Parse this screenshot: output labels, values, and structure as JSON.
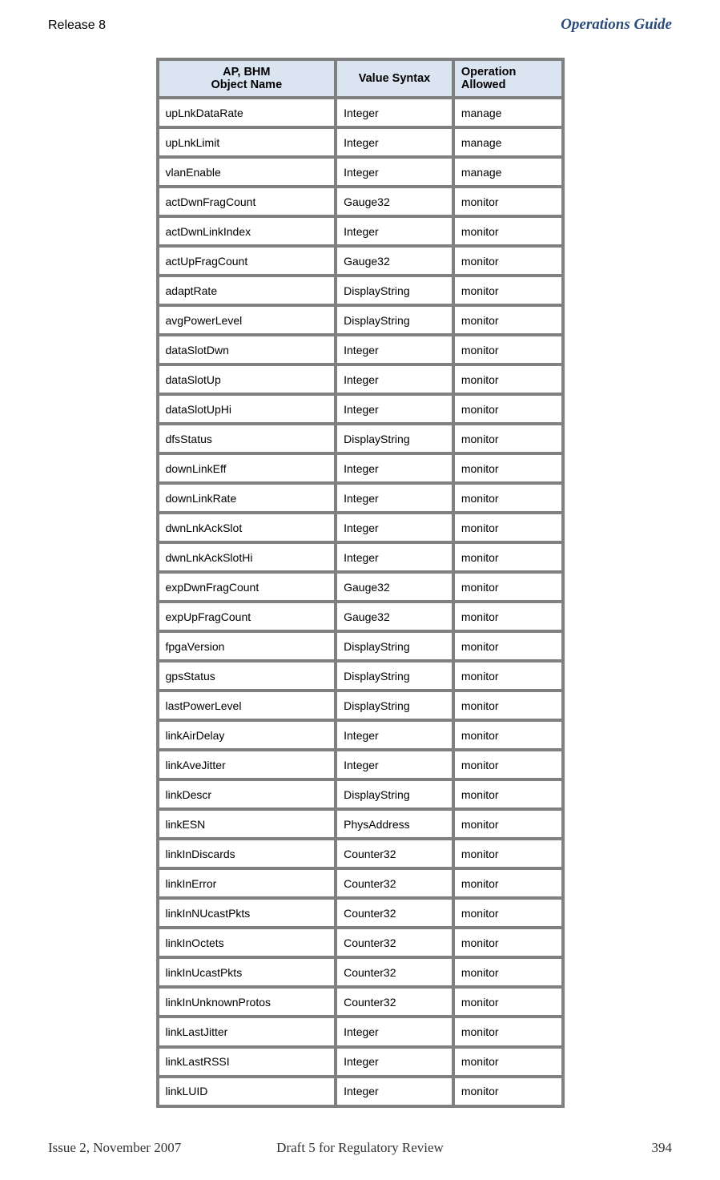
{
  "header": {
    "left": "Release 8",
    "right": "Operations Guide"
  },
  "footer": {
    "left": "Issue 2, November 2007",
    "center": "Draft 5 for Regulatory Review",
    "right": "394"
  },
  "table": {
    "headers": {
      "object_name_line1": "AP, BHM",
      "object_name_line2": "Object Name",
      "value_syntax": "Value Syntax",
      "operation_allowed_line1": "Operation",
      "operation_allowed_line2": "Allowed"
    },
    "rows": [
      {
        "name": "upLnkDataRate",
        "syntax": "Integer",
        "op": "manage"
      },
      {
        "name": "upLnkLimit",
        "syntax": "Integer",
        "op": "manage"
      },
      {
        "name": "vlanEnable",
        "syntax": "Integer",
        "op": "manage"
      },
      {
        "name": "actDwnFragCount",
        "syntax": "Gauge32",
        "op": "monitor"
      },
      {
        "name": "actDwnLinkIndex",
        "syntax": "Integer",
        "op": "monitor"
      },
      {
        "name": "actUpFragCount",
        "syntax": "Gauge32",
        "op": "monitor"
      },
      {
        "name": "adaptRate",
        "syntax": "DisplayString",
        "op": "monitor"
      },
      {
        "name": "avgPowerLevel",
        "syntax": "DisplayString",
        "op": "monitor"
      },
      {
        "name": "dataSlotDwn",
        "syntax": "Integer",
        "op": "monitor"
      },
      {
        "name": "dataSlotUp",
        "syntax": "Integer",
        "op": "monitor"
      },
      {
        "name": "dataSlotUpHi",
        "syntax": "Integer",
        "op": "monitor"
      },
      {
        "name": "dfsStatus",
        "syntax": "DisplayString",
        "op": "monitor"
      },
      {
        "name": "downLinkEff",
        "syntax": "Integer",
        "op": "monitor"
      },
      {
        "name": "downLinkRate",
        "syntax": "Integer",
        "op": "monitor"
      },
      {
        "name": "dwnLnkAckSlot",
        "syntax": "Integer",
        "op": "monitor"
      },
      {
        "name": "dwnLnkAckSlotHi",
        "syntax": "Integer",
        "op": "monitor"
      },
      {
        "name": "expDwnFragCount",
        "syntax": "Gauge32",
        "op": "monitor"
      },
      {
        "name": "expUpFragCount",
        "syntax": "Gauge32",
        "op": "monitor"
      },
      {
        "name": "fpgaVersion",
        "syntax": "DisplayString",
        "op": "monitor"
      },
      {
        "name": "gpsStatus",
        "syntax": "DisplayString",
        "op": "monitor"
      },
      {
        "name": "lastPowerLevel",
        "syntax": "DisplayString",
        "op": "monitor"
      },
      {
        "name": "linkAirDelay",
        "syntax": "Integer",
        "op": "monitor"
      },
      {
        "name": "linkAveJitter",
        "syntax": "Integer",
        "op": "monitor"
      },
      {
        "name": "linkDescr",
        "syntax": "DisplayString",
        "op": "monitor"
      },
      {
        "name": "linkESN",
        "syntax": "PhysAddress",
        "op": "monitor"
      },
      {
        "name": "linkInDiscards",
        "syntax": "Counter32",
        "op": "monitor"
      },
      {
        "name": "linkInError",
        "syntax": "Counter32",
        "op": "monitor"
      },
      {
        "name": "linkInNUcastPkts",
        "syntax": "Counter32",
        "op": "monitor"
      },
      {
        "name": "linkInOctets",
        "syntax": "Counter32",
        "op": "monitor"
      },
      {
        "name": "linkInUcastPkts",
        "syntax": "Counter32",
        "op": "monitor"
      },
      {
        "name": "linkInUnknownProtos",
        "syntax": "Counter32",
        "op": "monitor"
      },
      {
        "name": "linkLastJitter",
        "syntax": "Integer",
        "op": "monitor"
      },
      {
        "name": "linkLastRSSI",
        "syntax": "Integer",
        "op": "monitor"
      },
      {
        "name": "linkLUID",
        "syntax": "Integer",
        "op": "monitor"
      }
    ]
  }
}
